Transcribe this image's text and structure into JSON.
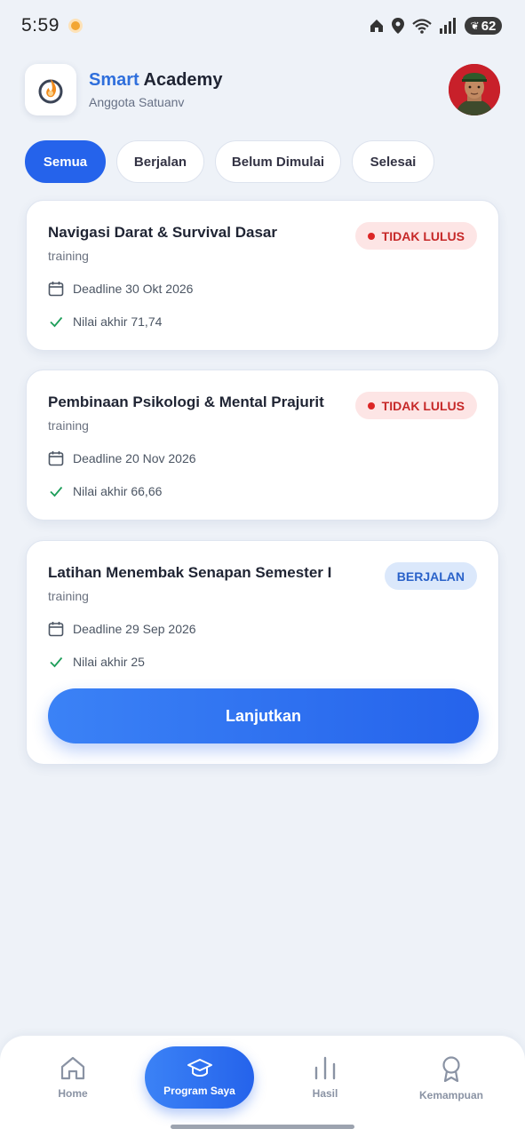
{
  "status_bar": {
    "time": "5:59",
    "battery": "62"
  },
  "header": {
    "title_accent": "Smart",
    "title_rest": " Academy",
    "subtitle": "Anggota Satuanv"
  },
  "tabs": [
    {
      "label": "Semua",
      "active": true
    },
    {
      "label": "Berjalan",
      "active": false
    },
    {
      "label": "Belum Dimulai",
      "active": false
    },
    {
      "label": "Selesai",
      "active": false
    }
  ],
  "courses": [
    {
      "title": "Navigasi Darat & Survival Dasar",
      "type": "training",
      "status": "TIDAK LULUS",
      "deadline": "Deadline 30 Okt 2026",
      "score": "Nilai akhir 71,74"
    },
    {
      "title": "Pembinaan Psikologi & Mental Prajurit",
      "type": "training",
      "status": "TIDAK LULUS",
      "deadline": "Deadline 20 Nov 2026",
      "score": "Nilai akhir 66,66"
    },
    {
      "title": "Latihan Menembak Senapan Semester I",
      "type": "training",
      "status": "BERJALAN",
      "deadline": "Deadline 29 Sep 2026",
      "score": "Nilai akhir 25",
      "action": "Lanjutkan"
    }
  ],
  "bottom_nav": {
    "home": "Home",
    "program": "Program Saya",
    "hasil": "Hasil",
    "kemampuan": "Kemampuan"
  },
  "colors": {
    "primary": "#2563eb",
    "fail_bg": "#fde5e5",
    "fail_text": "#c62828",
    "running_bg": "#dbe8fb",
    "running_text": "#2a62c9"
  }
}
